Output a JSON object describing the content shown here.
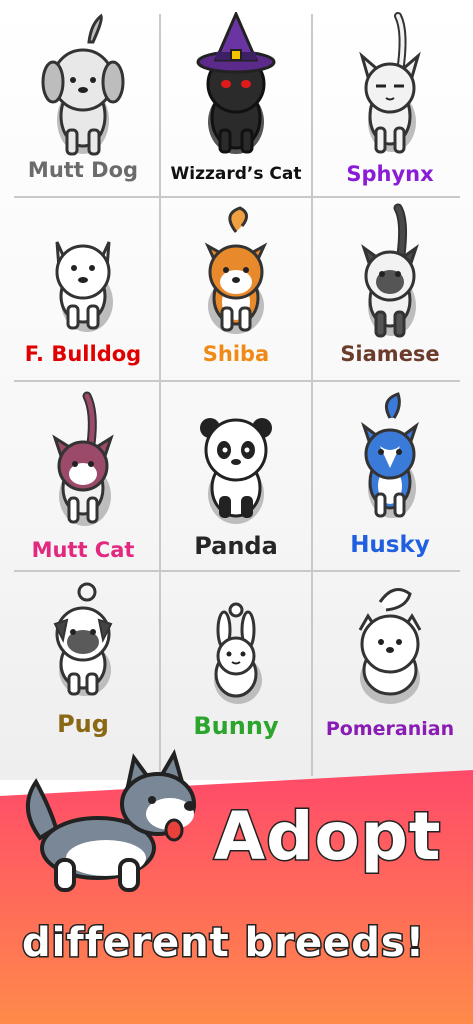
{
  "breeds": [
    {
      "name": "Mutt Dog",
      "color": "#6b6b6b"
    },
    {
      "name": "Wizzard’s Cat",
      "color": "#111111"
    },
    {
      "name": "Sphynx",
      "color": "#8a1bd6"
    },
    {
      "name": "F. Bulldog",
      "color": "#e00000"
    },
    {
      "name": "Shiba",
      "color": "#f08a16"
    },
    {
      "name": "Siamese",
      "color": "#6b3b2b"
    },
    {
      "name": "Mutt Cat",
      "color": "#e2287f"
    },
    {
      "name": "Panda",
      "color": "#262626"
    },
    {
      "name": "Husky",
      "color": "#1f5fe0"
    },
    {
      "name": "Pug",
      "color": "#8b6914"
    },
    {
      "name": "Bunny",
      "color": "#2ca52c"
    },
    {
      "name": "Pomeranian",
      "color": "#8a1bb5"
    }
  ],
  "banner": {
    "line1": "Adopt",
    "line2": "different breeds!",
    "gradient_top": "#ff4a6a",
    "gradient_bottom": "#ff8a4a"
  }
}
